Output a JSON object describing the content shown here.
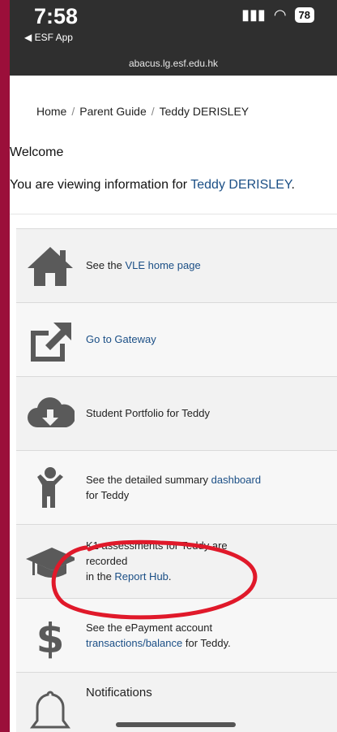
{
  "status": {
    "time": "7:58",
    "back_app": "◀ ESF App",
    "battery": "78"
  },
  "browser": {
    "url": "abacus.lg.esf.edu.hk"
  },
  "breadcrumb": {
    "home": "Home",
    "parent_guide": "Parent Guide",
    "student": "Teddy DERISLEY"
  },
  "welcome": "Welcome",
  "viewing": {
    "prefix": "You are viewing information for ",
    "name": "Teddy DERISLEY",
    "suffix": "."
  },
  "items": [
    {
      "icon": "house-icon",
      "prefix": "See the ",
      "link": "VLE home page",
      "suffix": ""
    },
    {
      "icon": "external-link-icon",
      "prefix": "",
      "link": "Go to Gateway",
      "suffix": ""
    },
    {
      "icon": "cloud-download-icon",
      "prefix": "Student Portfolio for Teddy",
      "link": "",
      "suffix": ""
    },
    {
      "icon": "child-icon",
      "prefix": "See the detailed summary ",
      "link": "dashboard",
      "suffix": "for Teddy"
    },
    {
      "icon": "graduation-cap-icon",
      "line1": "K1 assessments for Teddy are",
      "line2": "recorded",
      "line3_prefix": "in the ",
      "link": "Report Hub",
      "suffix": "."
    },
    {
      "icon": "dollar-icon",
      "line1": "See the ePayment account",
      "link": "transactions/balance",
      "suffix": " for Teddy."
    },
    {
      "icon": "bell-icon",
      "prefix": "Notifications"
    }
  ],
  "annotation_color": "#e0192a"
}
